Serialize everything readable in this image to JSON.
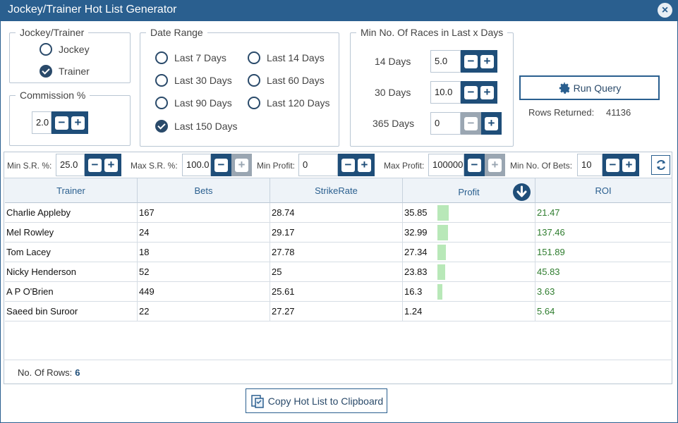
{
  "window": {
    "title": "Jockey/Trainer Hot List Generator",
    "close_icon": "×"
  },
  "jockey_trainer": {
    "legend": "Jockey/Trainer",
    "options": [
      {
        "label": "Jockey",
        "checked": false
      },
      {
        "label": "Trainer",
        "checked": true
      }
    ]
  },
  "commission": {
    "legend": "Commission %",
    "value": "2.0"
  },
  "date_range": {
    "legend": "Date Range",
    "options": [
      {
        "label": "Last 7 Days",
        "checked": false
      },
      {
        "label": "Last 14 Days",
        "checked": false
      },
      {
        "label": "Last 30 Days",
        "checked": false
      },
      {
        "label": "Last 60 Days",
        "checked": false
      },
      {
        "label": "Last 90 Days",
        "checked": false
      },
      {
        "label": "Last 120 Days",
        "checked": false
      },
      {
        "label": "Last 150 Days",
        "checked": true
      }
    ]
  },
  "min_races": {
    "legend": "Min No. Of Races in Last x Days",
    "rows": [
      {
        "label": "14 Days",
        "value": "5.0",
        "minus_disabled": false
      },
      {
        "label": "30 Days",
        "value": "10.0",
        "minus_disabled": false
      },
      {
        "label": "365 Days",
        "value": "0",
        "minus_disabled": true
      }
    ]
  },
  "run_query": {
    "label": "Run Query",
    "icon": "gear-icon"
  },
  "rows_returned": {
    "label": "Rows Returned:",
    "value": "41136"
  },
  "filters": {
    "min_sr": {
      "label": "Min S.R. %:",
      "value": "25.0"
    },
    "max_sr": {
      "label": "Max S.R. %:",
      "value": "100.0"
    },
    "min_profit": {
      "label": "Min Profit:",
      "value": "0"
    },
    "max_profit": {
      "label": "Max Profit:",
      "value": "100000"
    },
    "min_bets": {
      "label": "Min No. Of Bets:",
      "value": "10"
    }
  },
  "table": {
    "columns": [
      "Trainer",
      "Bets",
      "StrikeRate",
      "Profit",
      "ROI"
    ],
    "rows": [
      {
        "trainer": "Charlie Appleby",
        "bets": "167",
        "strike": "28.74",
        "profit": "35.85",
        "profit_fraction": 1.0,
        "roi": "21.47"
      },
      {
        "trainer": "Mel Rowley",
        "bets": "24",
        "strike": "29.17",
        "profit": "32.99",
        "profit_fraction": 0.92,
        "roi": "137.46"
      },
      {
        "trainer": "Tom Lacey",
        "bets": "18",
        "strike": "27.78",
        "profit": "27.34",
        "profit_fraction": 0.76,
        "roi": "151.89"
      },
      {
        "trainer": "Nicky Henderson",
        "bets": "52",
        "strike": "25",
        "profit": "23.83",
        "profit_fraction": 0.66,
        "roi": "45.83"
      },
      {
        "trainer": "A P O'Brien",
        "bets": "449",
        "strike": "25.61",
        "profit": "16.3",
        "profit_fraction": 0.45,
        "roi": "3.63"
      },
      {
        "trainer": "Saeed bin Suroor",
        "bets": "22",
        "strike": "27.27",
        "profit": "1.24",
        "profit_fraction": 0.0,
        "roi": "5.64"
      }
    ]
  },
  "footer": {
    "rows_label": "No. Of Rows:",
    "rows_value": "6"
  },
  "copy": {
    "label": "Copy Hot List to Clipboard",
    "icon": "clipboard-icon"
  },
  "colors": {
    "accent": "#2a5f8f",
    "spinner": "#1f4e79",
    "roi_text": "#2f7d2f",
    "profit_bar": "#b8e8b8"
  }
}
